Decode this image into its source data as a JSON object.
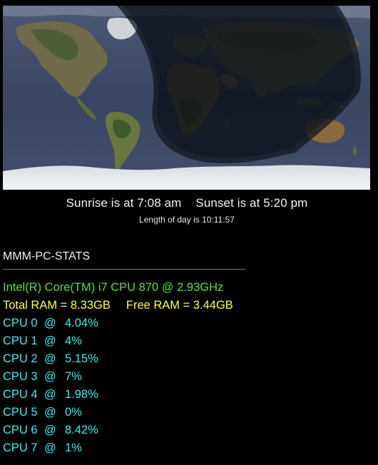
{
  "sun": {
    "sunrise": "Sunrise is at 7:08 am",
    "sunset": "Sunset is at 5:20 pm",
    "length": "Length of day is 10:11:57"
  },
  "stats": {
    "header": "MMM-PC-STATS",
    "cpu_model": "Intel(R) Core(TM) i7 CPU 870 @ 2.93GHz",
    "total_ram": "Total RAM = 8.33GB",
    "free_ram": "Free RAM = 3.44GB",
    "cpus": [
      {
        "label": "CPU 0",
        "at": "@",
        "usage": "4.04%"
      },
      {
        "label": "CPU 1",
        "at": "@",
        "usage": "4%"
      },
      {
        "label": "CPU 2",
        "at": "@",
        "usage": "5.15%"
      },
      {
        "label": "CPU 3",
        "at": "@",
        "usage": "7%"
      },
      {
        "label": "CPU 4",
        "at": "@",
        "usage": "1.98%"
      },
      {
        "label": "CPU 5",
        "at": "@",
        "usage": "0%"
      },
      {
        "label": "CPU 6",
        "at": "@",
        "usage": "8.42%"
      },
      {
        "label": "CPU 7",
        "at": "@",
        "usage": "1%"
      }
    ]
  },
  "colors": {
    "cpu_name": "#4fe334",
    "ram": "#ffff3a",
    "cpu_rows": "#2ff0f0"
  }
}
